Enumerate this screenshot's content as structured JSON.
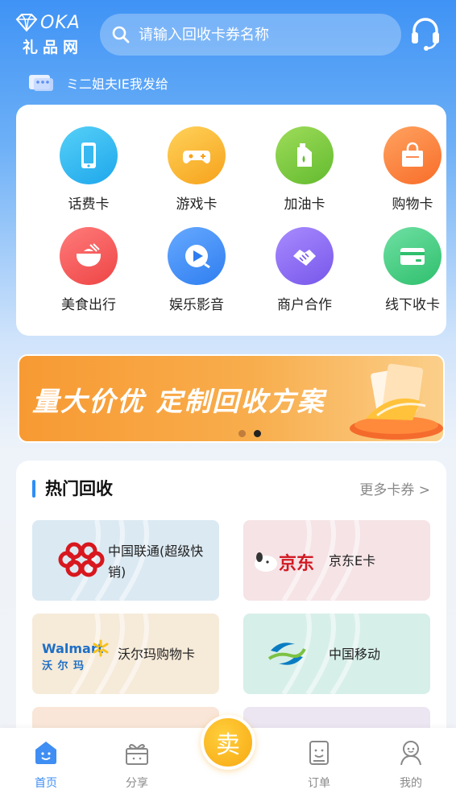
{
  "header": {
    "logo_word": "OKA",
    "logo_sub": "礼品网",
    "search_placeholder": "请输入回收卡券名称"
  },
  "notice": {
    "text": "ミ二姐夫IE我发给"
  },
  "categories": [
    {
      "label": "话费卡",
      "icon": "phone-icon",
      "color": "#2fb8ef"
    },
    {
      "label": "游戏卡",
      "icon": "gamepad-icon",
      "color": "#f9b02d"
    },
    {
      "label": "加油卡",
      "icon": "fuel-can-icon",
      "color": "#7ccb3c"
    },
    {
      "label": "购物卡",
      "icon": "shopping-bag-icon",
      "color": "#fb8a3d"
    },
    {
      "label": "美食出行",
      "icon": "food-bowl-icon",
      "color": "#f25a5a"
    },
    {
      "label": "娱乐影音",
      "icon": "play-icon",
      "color": "#3d8df2"
    },
    {
      "label": "商户合作",
      "icon": "handshake-icon",
      "color": "#8a6cf0"
    },
    {
      "label": "线下收卡",
      "icon": "card-icon",
      "color": "#3ecb7d"
    }
  ],
  "banner": {
    "text": "量大价优 定制回收方案",
    "active_dot": 1
  },
  "hot": {
    "title": "热门回收",
    "more": "更多卡券 >",
    "items": [
      {
        "name": "中国联通(超级快销)",
        "logo": "china-unicom-logo",
        "bg": "#dbe9f2"
      },
      {
        "name": "京东E卡",
        "logo": "jd-logo",
        "logo_text": "京东",
        "bg": "#f5e3e6"
      },
      {
        "name": "沃尔玛购物卡",
        "logo": "walmart-logo",
        "logo_text": "Walmart",
        "logo_sub": "沃 尔 玛",
        "bg": "#f6ead9"
      },
      {
        "name": "中国移动",
        "logo": "china-mobile-logo",
        "bg": "#d7efe9"
      }
    ]
  },
  "tabbar": {
    "tabs": [
      {
        "label": "首页",
        "icon": "home-icon",
        "active": true
      },
      {
        "label": "分享",
        "icon": "gift-icon",
        "active": false
      },
      {
        "label": "订单",
        "icon": "order-icon",
        "active": false
      },
      {
        "label": "我的",
        "icon": "profile-icon",
        "active": false
      }
    ],
    "sell_label": "卖"
  },
  "colors": {
    "accent": "#3f8ef3",
    "sell": "#f7a812"
  }
}
